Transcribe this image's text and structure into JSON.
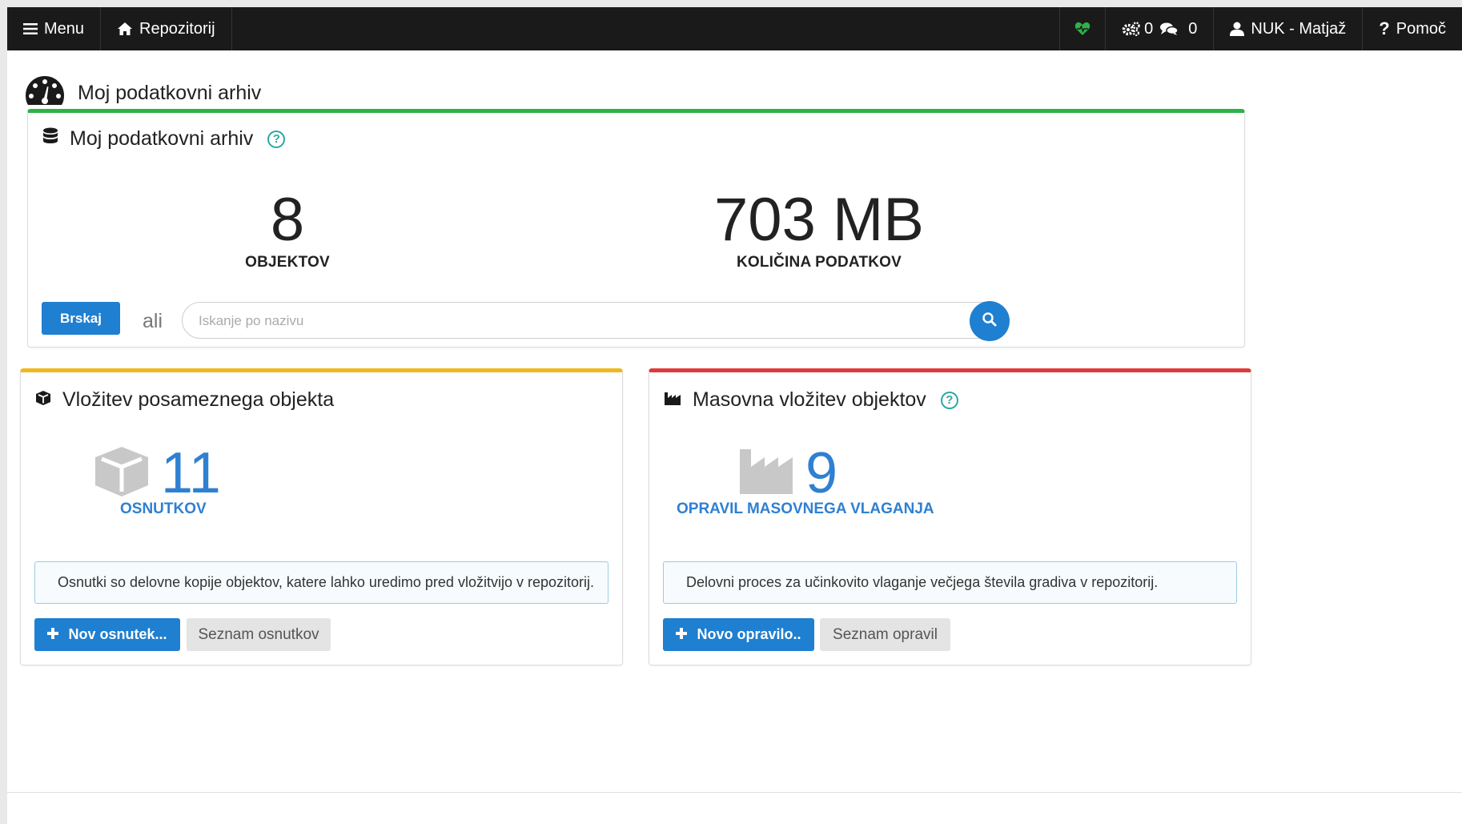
{
  "navbar": {
    "menu_label": "Menu",
    "repo_label": "Repozitorij",
    "tasks_count": "0",
    "messages_count": "0",
    "user_label": "NUK - Matjaž",
    "help_label": "Pomoč",
    "heart_color": "#2fb14a"
  },
  "page": {
    "title": "Moj podatkovni arhiv"
  },
  "archive": {
    "title": "Moj podatkovni arhiv",
    "objects_value": "8",
    "objects_label": "OBJEKTOV",
    "size_value": "703 MB",
    "size_label": "KOLIČINA PODATKOV",
    "browse_label": "Brskaj",
    "or_label": "ali",
    "search_placeholder": "Iskanje po nazivu",
    "accent_color": "#2fb14a"
  },
  "single": {
    "title": "Vložitev posameznega objekta",
    "count": "11",
    "count_label": "OSNUTKOV",
    "info": "Osnutki so delovne kopije objektov, katere lahko uredimo pred vložitvijo v repozitorij.",
    "new_label": "Nov osnutek...",
    "list_label": "Seznam osnutkov",
    "accent_color": "#f0b81c"
  },
  "bulk": {
    "title": "Masovna vložitev objektov",
    "count": "9",
    "count_label": "OPRAVIL MASOVNEGA VLAGANJA",
    "info": "Delovni proces za učinkovito vlaganje večjega števila gradiva v repozitorij.",
    "new_label": "Novo opravilo..",
    "list_label": "Seznam opravil",
    "accent_color": "#e03a3a"
  }
}
